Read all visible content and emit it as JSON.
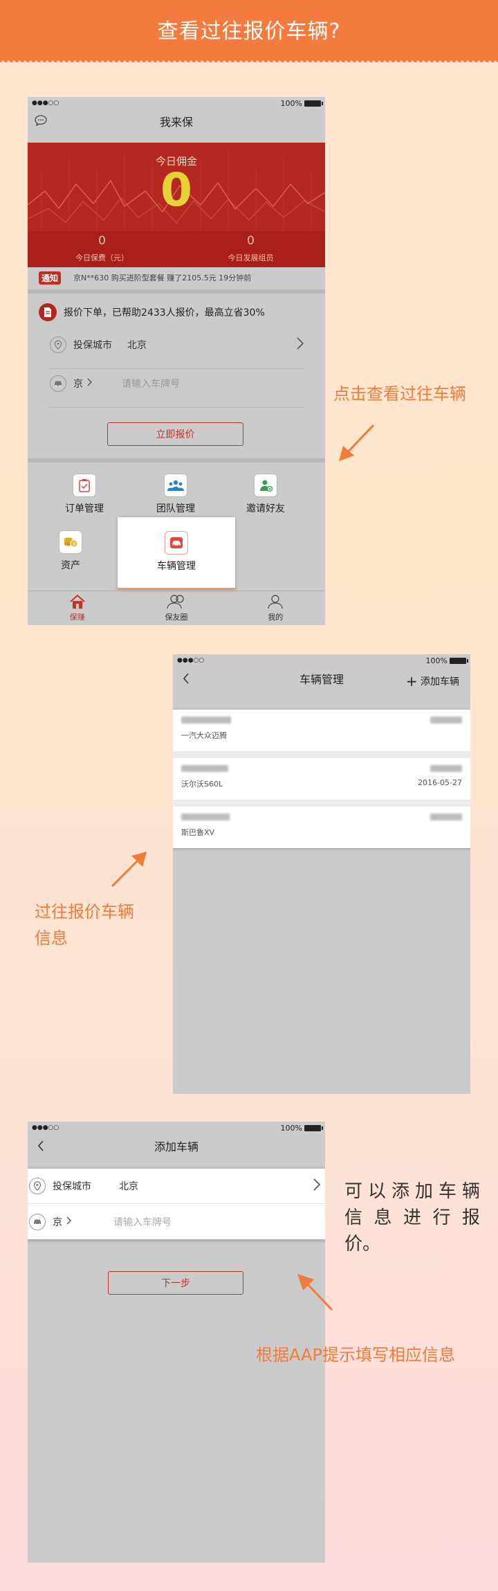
{
  "banner": {
    "title": "查看过往报价车辆?"
  },
  "colors": {
    "accent": "#f47a3e",
    "brand_red": "#c2342a",
    "hero_red": "#b6271f",
    "gold": "#e6d336"
  },
  "screen1": {
    "status": {
      "signal": "●●●○○",
      "battery": "100%"
    },
    "nav_title": "我来保",
    "chat_icon": "chat-bubble-icon",
    "hero": {
      "label": "今日佣金",
      "value": "0",
      "stats": [
        {
          "value": "0",
          "label": "今日保费（元）"
        },
        {
          "value": "0",
          "label": "今日发展组员"
        }
      ]
    },
    "notice": {
      "tag": "通知",
      "text": "京N**630 购买进阶型套餐 赚了2105.5元 19分钟前"
    },
    "quote": {
      "headline": "报价下单，已帮助2433人报价，最高立省30%",
      "city_label": "投保城市",
      "city_value": "北京",
      "plate_prefix": "京",
      "plate_placeholder": "请输入车牌号",
      "submit_label": "立即报价"
    },
    "grid": [
      {
        "label": "订单管理",
        "icon": "clipboard-icon"
      },
      {
        "label": "团队管理",
        "icon": "team-icon"
      },
      {
        "label": "邀请好友",
        "icon": "invite-user-icon"
      },
      {
        "label": "资产",
        "icon": "coins-icon"
      },
      {
        "label": "车辆管理",
        "icon": "car-icon"
      }
    ],
    "tabs": [
      {
        "label": "保赚",
        "icon": "home-icon"
      },
      {
        "label": "保友圈",
        "icon": "friends-icon"
      },
      {
        "label": "我的",
        "icon": "person-icon"
      }
    ]
  },
  "annotation1": "点击查看过往车辆",
  "screen2": {
    "status": {
      "signal": "●●●○○",
      "battery": "100%"
    },
    "nav_title": "车辆管理",
    "add_label": "添加车辆",
    "vehicles": [
      {
        "model": "一汽大众迈腾",
        "date": ""
      },
      {
        "model": "沃尔沃S60L",
        "date": "2016-05-27"
      },
      {
        "model": "斯巴鲁XV",
        "date": ""
      }
    ]
  },
  "annotation2": [
    "过往报价车辆",
    "信息"
  ],
  "screen3": {
    "status": {
      "signal": "●●●○○",
      "battery": "100%"
    },
    "nav_title": "添加车辆",
    "city_label": "投保城市",
    "city_value": "北京",
    "plate_prefix": "京",
    "plate_placeholder": "请输入车牌号",
    "next_label": "下一步"
  },
  "side_text": [
    "可以添加车辆",
    "信息进行报",
    "价。"
  ],
  "annotation3": "根据AAP提示填写相应信息"
}
